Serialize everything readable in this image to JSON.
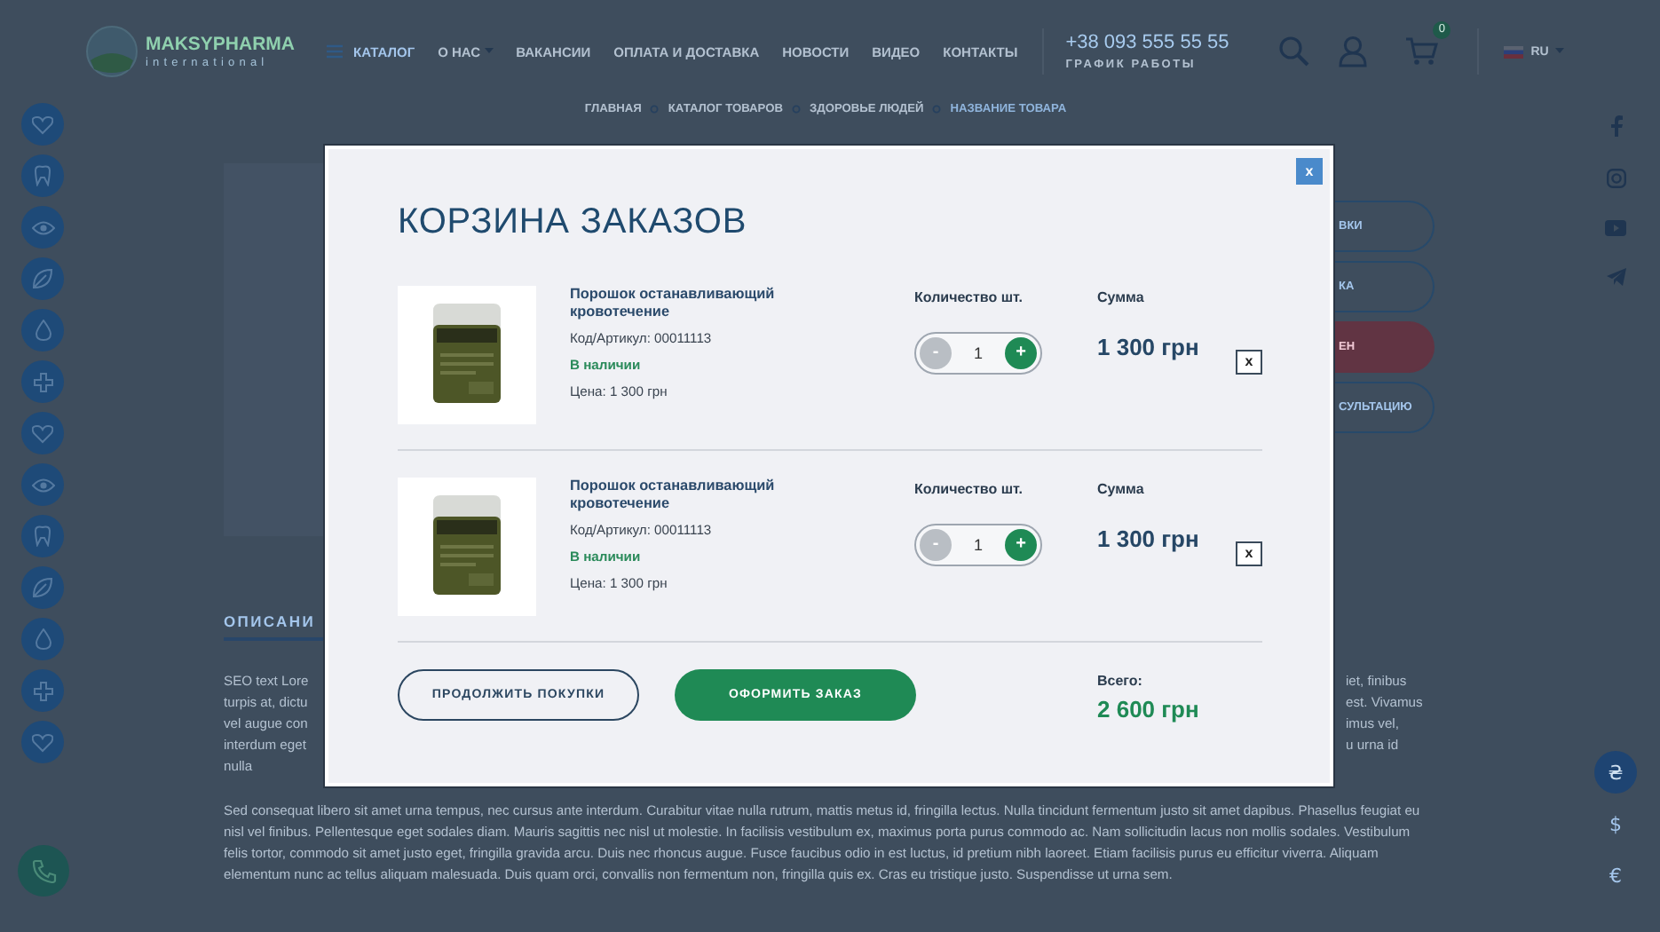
{
  "header": {
    "logo": {
      "name": "MAKSYPHARMA",
      "tagline": "international"
    },
    "nav": [
      {
        "label": "КАТАЛОГ",
        "kind": "catalog"
      },
      {
        "label": "О НАС",
        "kind": "dropdown"
      },
      {
        "label": "ВАКАНСИИ",
        "kind": "link"
      },
      {
        "label": "ОПЛАТА И ДОСТАВКА",
        "kind": "link"
      },
      {
        "label": "НОВОСТИ",
        "kind": "link"
      },
      {
        "label": "ВИДЕО",
        "kind": "link"
      },
      {
        "label": "КОНТАКТЫ",
        "kind": "link"
      }
    ],
    "phone": "+38 093 555 55 55",
    "schedule": "ГРАФИК РАБОТЫ",
    "cart_count": "0",
    "language": "RU"
  },
  "breadcrumbs": [
    {
      "label": "ГЛАВНАЯ",
      "current": false
    },
    {
      "label": "КАТАЛОГ ТОВАРОВ",
      "current": false
    },
    {
      "label": "ЗДОРОВЬЕ ЛЮДЕЙ",
      "current": false
    },
    {
      "label": "НАЗВАНИЕ ТОВАРА",
      "current": true
    }
  ],
  "product_actions": [
    {
      "label": "ВКИ",
      "kind": "outline"
    },
    {
      "label": "КА",
      "kind": "outline"
    },
    {
      "label": "ЕН",
      "kind": "filled"
    },
    {
      "label": "СУЛЬТАЦИЮ",
      "kind": "outline"
    }
  ],
  "description": {
    "heading": "ОПИСАНИ",
    "left_fragments": [
      "SEO text Lore",
      "turpis at, dictu",
      "vel augue con",
      "interdum eget",
      "nulla"
    ],
    "right_fragments": [
      "iet, finibus",
      "est. Vivamus",
      "imus vel,",
      "u urna id"
    ],
    "paragraph": "Sed consequat libero sit amet urna tempus, nec cursus ante interdum. Curabitur vitae nulla rutrum, mattis metus id, fringilla lectus. Nulla tincidunt fermentum justo sit amet dapibus. Phasellus feugiat eu nisl vel finibus. Pellentesque eget sodales diam. Mauris sagittis nec nisl ut molestie. In facilisis vestibulum ex, maximus porta purus commodo ac. Nam sollicitudin lacus non mollis sodales. Vestibulum felis tortor, commodo sit amet justo eget, fringilla gravida arcu. Duis nec rhoncus augue. Fusce faucibus odio in est luctus, id pretium nibh laoreet. Etiam facilisis purus eu efficitur viverra. Aliquam elementum nunc ac tellus aliquam malesuada. Duis quam orci, convallis non fermentum non, fringilla quis ex. Cras eu tristique justo. Suspendisse ut urna sem."
  },
  "currencies": [
    {
      "symbol": "₴",
      "selected": true
    },
    {
      "symbol": "$",
      "selected": false
    },
    {
      "symbol": "€",
      "selected": false
    }
  ],
  "cart_modal": {
    "close": "x",
    "title": "КОРЗИНА ЗАКАЗОВ",
    "items": [
      {
        "name": "Порошок останавливающий кровотечение",
        "code": "Код/Артикул: 00011113",
        "availability": "В наличии",
        "price": "Цена: 1 300 грн",
        "qty_label": "Количество шт.",
        "minus": "-",
        "quantity": "1",
        "plus": "+",
        "can_decrease": false,
        "sum_label": "Сумма",
        "sum": "1 300 грн",
        "remove": "x"
      },
      {
        "name": "Порошок останавливающий кровотечение",
        "code": "Код/Артикул: 00011113",
        "availability": "В наличии",
        "price": "Цена: 1 300 грн",
        "qty_label": "Количество шт.",
        "minus": "-",
        "quantity": "1",
        "plus": "+",
        "can_decrease": false,
        "sum_label": "Сумма",
        "sum": "1 300 грн",
        "remove": "x"
      }
    ],
    "continue": "ПРОДОЛЖИТЬ ПОКУПКИ",
    "checkout": "ОФОРМИТЬ ЗАКАЗ",
    "total_label": "Всего:",
    "total": "2 600 грн"
  }
}
